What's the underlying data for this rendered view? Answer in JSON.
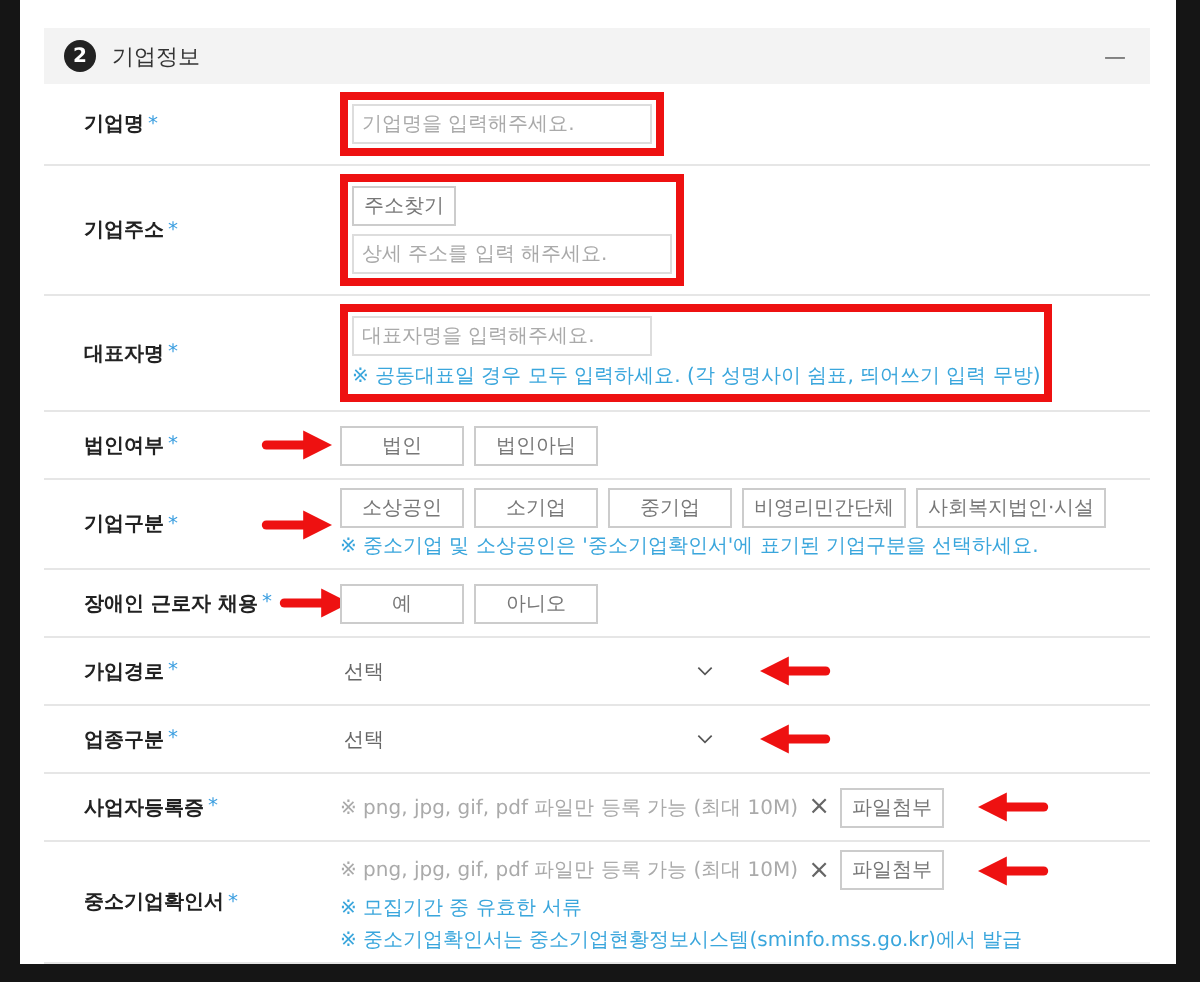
{
  "section": {
    "number": "2",
    "title": "기업정보",
    "collapse": "—"
  },
  "rows": [
    {
      "label": "기업명",
      "mark": "*",
      "kind": "text",
      "annotation": {
        "kind": "frame"
      },
      "placeholder": "기업명을 입력해주세요."
    },
    {
      "label": "기업주소",
      "mark": "*",
      "kind": "address",
      "annotation": {
        "kind": "frame"
      },
      "button": "주소찾기",
      "placeholder": "상세 주소를 입력 해주세요."
    },
    {
      "label": "대표자명",
      "mark": "*",
      "kind": "text",
      "annotation": {
        "kind": "frame"
      },
      "placeholder": "대표자명을 입력해주세요.",
      "notes": [
        "※ 공동대표일 경우 모두 입력하세요. (각 성명사이 쉼표, 띄어쓰기 입력 무방)"
      ]
    },
    {
      "label": "법인여부",
      "mark": "*",
      "kind": "choices",
      "annotation": {
        "kind": "rightarrow"
      },
      "options": [
        "법인",
        "법인아님"
      ]
    },
    {
      "label": "기업구분",
      "mark": "*",
      "kind": "choices",
      "annotation": {
        "kind": "rightarrow"
      },
      "options": [
        "소상공인",
        "소기업",
        "중기업",
        "비영리민간단체",
        "사회복지법인·시설"
      ],
      "notes": [
        "※ 중소기업 및 소상공인은 '중소기업확인서'에 표기된 기업구분을 선택하세요."
      ]
    },
    {
      "label": "장애인 근로자 채용",
      "mark": "*",
      "kind": "choices",
      "annotation": {
        "kind": "rightarrow"
      },
      "options": [
        "예",
        "아니오"
      ]
    },
    {
      "label": "가입경로",
      "mark": "*",
      "kind": "select",
      "annotation": {
        "kind": "leftarrow"
      },
      "value": "선택"
    },
    {
      "label": "업종구분",
      "mark": "*",
      "kind": "select",
      "annotation": {
        "kind": "leftarrow"
      },
      "value": "선택"
    },
    {
      "label": "사업자등록증",
      "mark": "*",
      "kind": "file",
      "annotation": {
        "kind": "leftarrow"
      },
      "hint": "※ png, jpg, gif, pdf 파일만 등록 가능 (최대 10M)",
      "remove": "×",
      "button": "파일첨부"
    },
    {
      "label": "중소기업확인서",
      "mark": "*",
      "kind": "file",
      "annotation": {
        "kind": "leftarrow"
      },
      "hint": "※ png, jpg, gif, pdf 파일만 등록 가능 (최대 10M)",
      "remove": "×",
      "button": "파일첨부",
      "notes": [
        "※ 모집기간 중 유효한 서류",
        "※ 중소기업확인서는 중소기업현황정보시스템(sminfo.mss.go.kr)에서 발급"
      ]
    }
  ]
}
